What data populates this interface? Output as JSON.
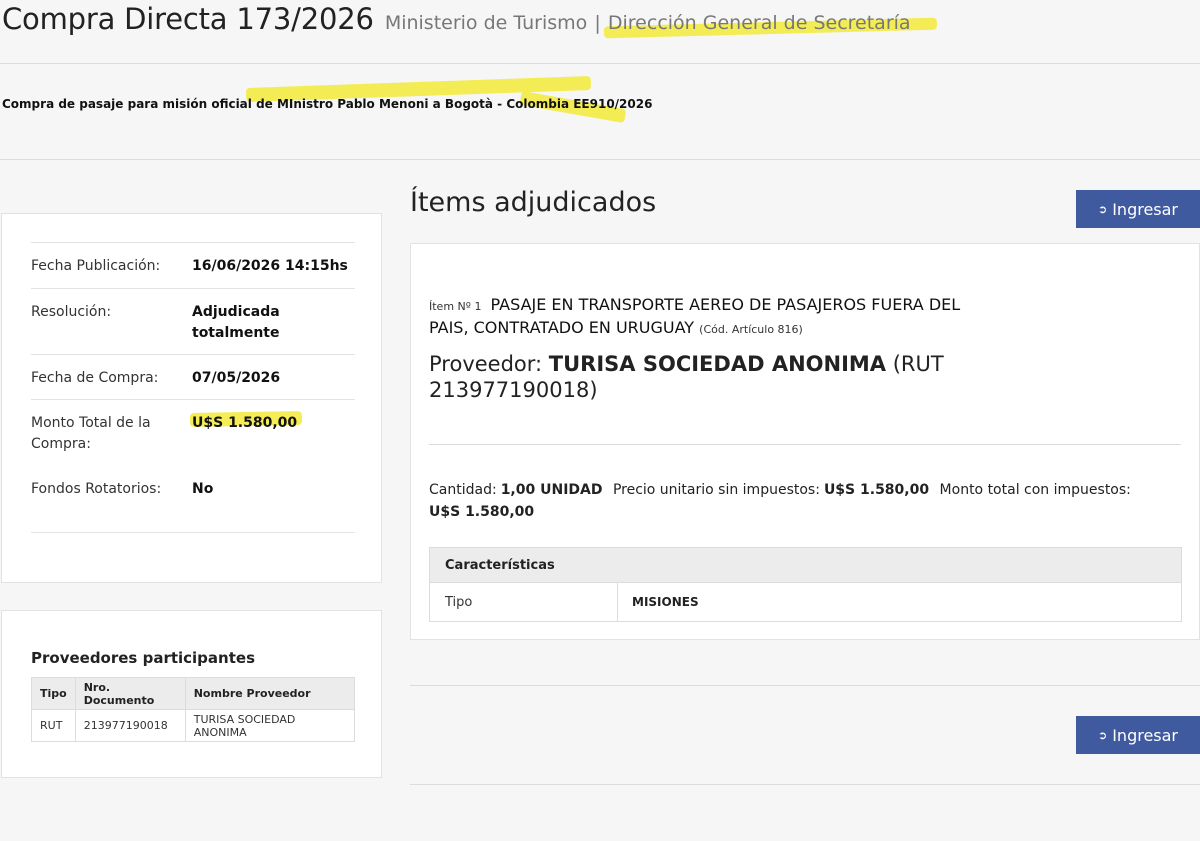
{
  "header": {
    "title": "Compra Directa 173/2026",
    "organization": "Ministerio de Turismo",
    "separator": "|",
    "department": "Dirección General de Secretaría",
    "description": "Compra de pasaje para misión oficial de MInistro Pablo Menoni a Bogotà - Colombia EE910/2026"
  },
  "info": {
    "rows": [
      {
        "label": "Fecha Publicación:",
        "value": "16/06/2026 14:15hs"
      },
      {
        "label": "Resolución:",
        "value": "Adjudicada totalmente"
      },
      {
        "label": "Fecha de Compra:",
        "value": "07/05/2026"
      },
      {
        "label": "Monto Total de la Compra:",
        "value": "U$S 1.580,00"
      },
      {
        "label": "Fondos Rotatorios:",
        "value": "No"
      }
    ]
  },
  "proveedores": {
    "title": "Proveedores participantes",
    "columns": [
      "Tipo",
      "Nro. Documento",
      "Nombre Proveedor"
    ],
    "rows": [
      [
        "RUT",
        "213977190018",
        "TURISA SOCIEDAD ANONIMA"
      ]
    ]
  },
  "items": {
    "title": "Ítems adjudicados",
    "button_label": "Ingresar",
    "item": {
      "number_label": "Ítem Nº 1",
      "description": "PASAJE EN TRANSPORTE AEREO DE PASAJEROS FUERA DEL PAIS, CONTRATADO EN URUGUAY",
      "code": "(Cód. Artículo 816)",
      "proveedor_label": "Proveedor:",
      "proveedor_name": "TURISA SOCIEDAD ANONIMA",
      "proveedor_rut": "(RUT 213977190018)",
      "cantidad_label": "Cantidad:",
      "cantidad_value": "1,00 UNIDAD",
      "precio_label": "Precio unitario sin impuestos:",
      "precio_value": "U$S 1.580,00",
      "monto_label": "Monto total con impuestos:",
      "monto_value": "U$S 1.580,00",
      "caracteristicas_title": "Características",
      "caracteristicas": [
        {
          "key": "Tipo",
          "value": "MISIONES"
        }
      ]
    }
  },
  "colors": {
    "button": "#3f5a9e",
    "highlight": "#f3ea38",
    "background": "#f5f6f5"
  }
}
